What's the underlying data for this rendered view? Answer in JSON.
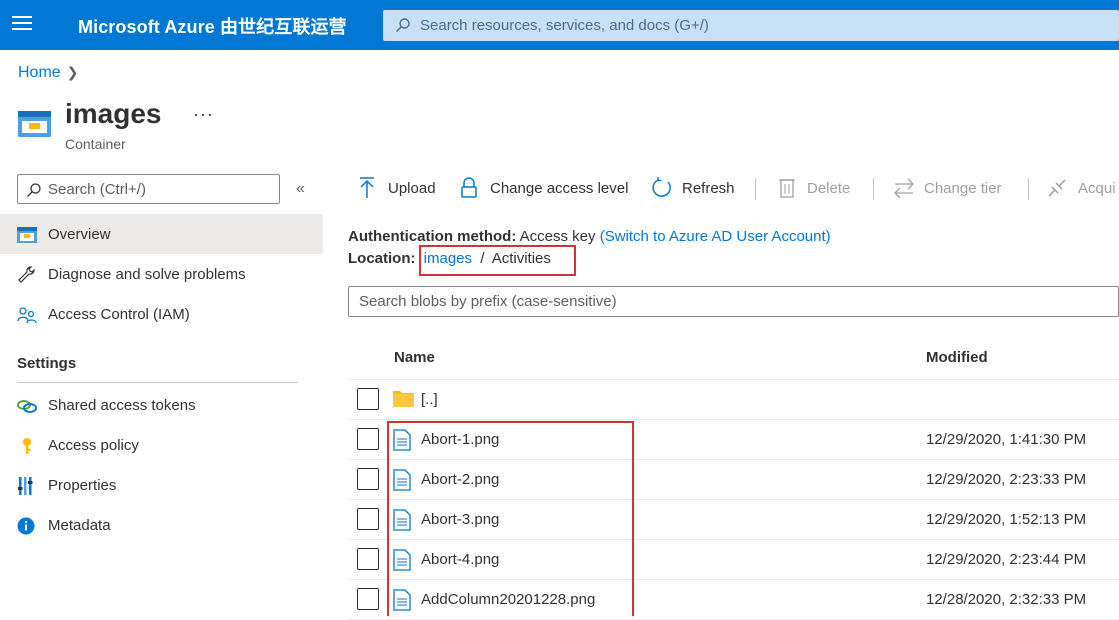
{
  "topbar": {
    "brand": "Microsoft Azure 由世纪互联运营",
    "search_placeholder": "Search resources, services, and docs (G+/)"
  },
  "breadcrumb": {
    "home": "Home"
  },
  "resource": {
    "title": "images",
    "subtitle": "Container",
    "more": "···"
  },
  "nav": {
    "search_placeholder": "Search (Ctrl+/)",
    "collapse": "«",
    "items": [
      {
        "label": "Overview",
        "icon": "container-icon",
        "active": true
      },
      {
        "label": "Diagnose and solve problems",
        "icon": "wrench-icon"
      },
      {
        "label": "Access Control (IAM)",
        "icon": "people-icon"
      }
    ],
    "section_settings": "Settings",
    "settings_items": [
      {
        "label": "Shared access tokens",
        "icon": "link-icon"
      },
      {
        "label": "Access policy",
        "icon": "key-icon"
      },
      {
        "label": "Properties",
        "icon": "bars-icon"
      },
      {
        "label": "Metadata",
        "icon": "info-icon"
      }
    ]
  },
  "toolbar": {
    "upload": "Upload",
    "change_access": "Change access level",
    "refresh": "Refresh",
    "delete": "Delete",
    "change_tier": "Change tier",
    "acquire": "Acqui"
  },
  "info": {
    "auth_label": "Authentication method:",
    "auth_value": "Access key",
    "auth_link": "(Switch to Azure AD User Account)",
    "location_label": "Location:",
    "location_link": "images",
    "location_sep": "/",
    "location_folder": "Activities"
  },
  "blob_search_placeholder": "Search blobs by prefix (case-sensitive)",
  "table": {
    "col_name": "Name",
    "col_modified": "Modified",
    "parent_folder": "[..]",
    "rows": [
      {
        "name": "Abort-1.png",
        "modified": "12/29/2020, 1:41:30 PM"
      },
      {
        "name": "Abort-2.png",
        "modified": "12/29/2020, 2:23:33 PM"
      },
      {
        "name": "Abort-3.png",
        "modified": "12/29/2020, 1:52:13 PM"
      },
      {
        "name": "Abort-4.png",
        "modified": "12/29/2020, 2:23:44 PM"
      },
      {
        "name": "AddColumn20201228.png",
        "modified": "12/28/2020, 2:32:33 PM"
      }
    ]
  },
  "colors": {
    "accent": "#0078d4",
    "highlight": "#d13438",
    "folder": "#ffb900"
  }
}
